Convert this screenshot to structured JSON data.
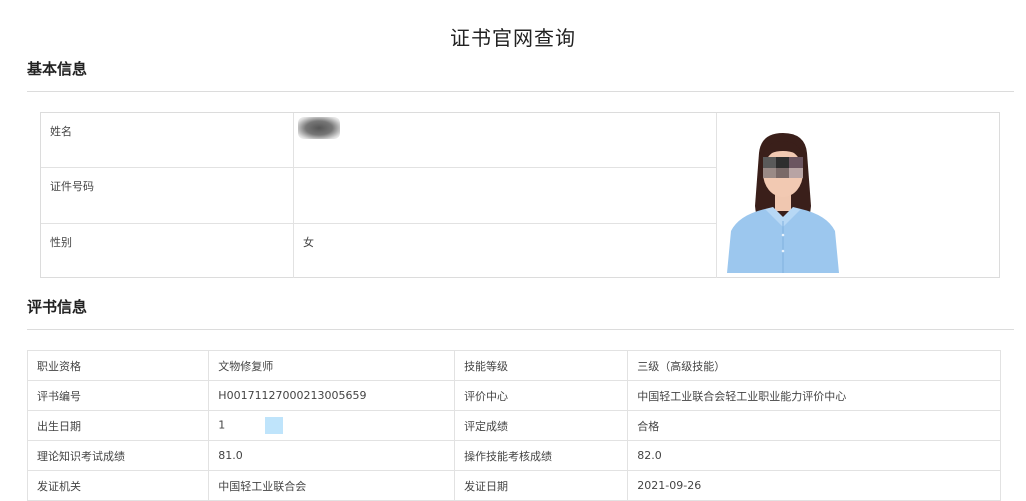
{
  "page": {
    "title": "证书官网查询"
  },
  "basic_info": {
    "section_title": "基本信息",
    "rows": [
      {
        "label": "姓名",
        "value": ""
      },
      {
        "label": "证件号码",
        "value": ""
      },
      {
        "label": "性别",
        "value": "女"
      }
    ]
  },
  "cert_info": {
    "section_title": "评书信息",
    "rows": [
      {
        "l1": "职业资格",
        "v1": "文物修复师",
        "l2": "技能等级",
        "v2": "三级（高级技能）"
      },
      {
        "l1": "评书编号",
        "v1": "H00171127000213005659",
        "l2": "评价中心",
        "v2": "中国轻工业联合会轻工业职业能力评价中心"
      },
      {
        "l1": "出生日期",
        "v1": "1\t",
        "l2": "评定成绩",
        "v2": "合格"
      },
      {
        "l1": "理论知识考试成绩",
        "v1": "81.0",
        "l2": "操作技能考核成绩",
        "v2": "82.0"
      },
      {
        "l1": "发证机关",
        "v1": "中国轻工业联合会",
        "l2": "发证日期",
        "v2": "2021-09-26"
      }
    ]
  },
  "colors": {
    "border": "#e2e2e2",
    "shirt": "#9cc7ee",
    "hair": "#3a1f1a",
    "blur_blue": "#bfe4fb"
  }
}
